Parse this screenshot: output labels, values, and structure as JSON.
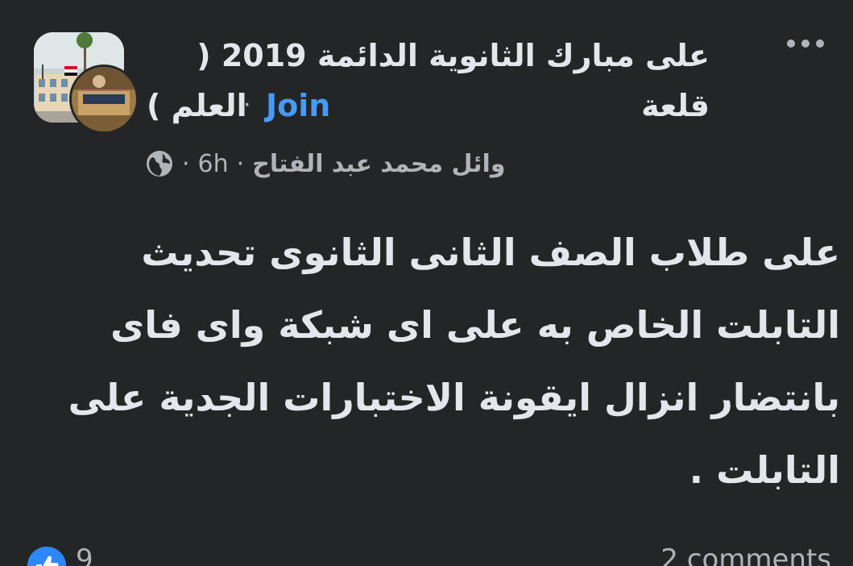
{
  "header": {
    "group_name_line1": "على مبارك الثانوية الدائمة 2019 ( قلعة",
    "group_name_line2": "العلم )",
    "separator": "·",
    "join_label": "Join"
  },
  "meta": {
    "author": "وائل محمد عبد الفتاح",
    "separator": "·",
    "time": "6h",
    "privacy_icon": "globe-icon"
  },
  "post": {
    "text": "على طلاب الصف الثانى الثانوى تحديث التابلت الخاص به على اى شبكة واى فاى بانتضار انزال ايقونة الاختبارات الجدية على التابلت ."
  },
  "footer": {
    "reaction_count": "9",
    "comments_label": "2 comments",
    "reaction_icon": "like-icon"
  },
  "colors": {
    "background": "#242526",
    "text_primary": "#e4e6eb",
    "text_secondary": "#b0b3b8",
    "link": "#4599ff",
    "like": "#2d88ff"
  }
}
